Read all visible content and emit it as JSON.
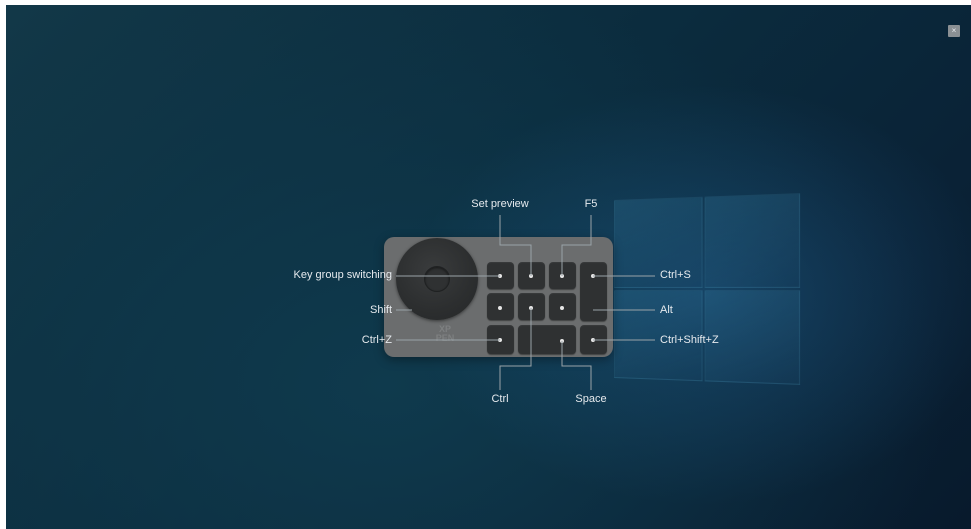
{
  "window": {
    "close_glyph": "×",
    "accent": "#0b2c3e"
  },
  "device": {
    "brand_logo_text": "XP\nPEN",
    "keys": [
      {
        "name": "key-row1-col1"
      },
      {
        "name": "key-row1-col2"
      },
      {
        "name": "key-row1-col3"
      },
      {
        "name": "key-tall-right"
      },
      {
        "name": "key-row2-col1"
      },
      {
        "name": "key-row2-col2"
      },
      {
        "name": "key-row2-col3"
      },
      {
        "name": "key-row3-col1"
      },
      {
        "name": "key-wide-space"
      },
      {
        "name": "key-row3-col4"
      }
    ]
  },
  "labels": {
    "key_group_switching": "Key group switching",
    "shift": "Shift",
    "ctrl_z": "Ctrl+Z",
    "set_preview": "Set preview",
    "f5": "F5",
    "ctrl_s": "Ctrl+S",
    "alt": "Alt",
    "ctrl_shift_z": "Ctrl+Shift+Z",
    "ctrl": "Ctrl",
    "space": "Space"
  }
}
